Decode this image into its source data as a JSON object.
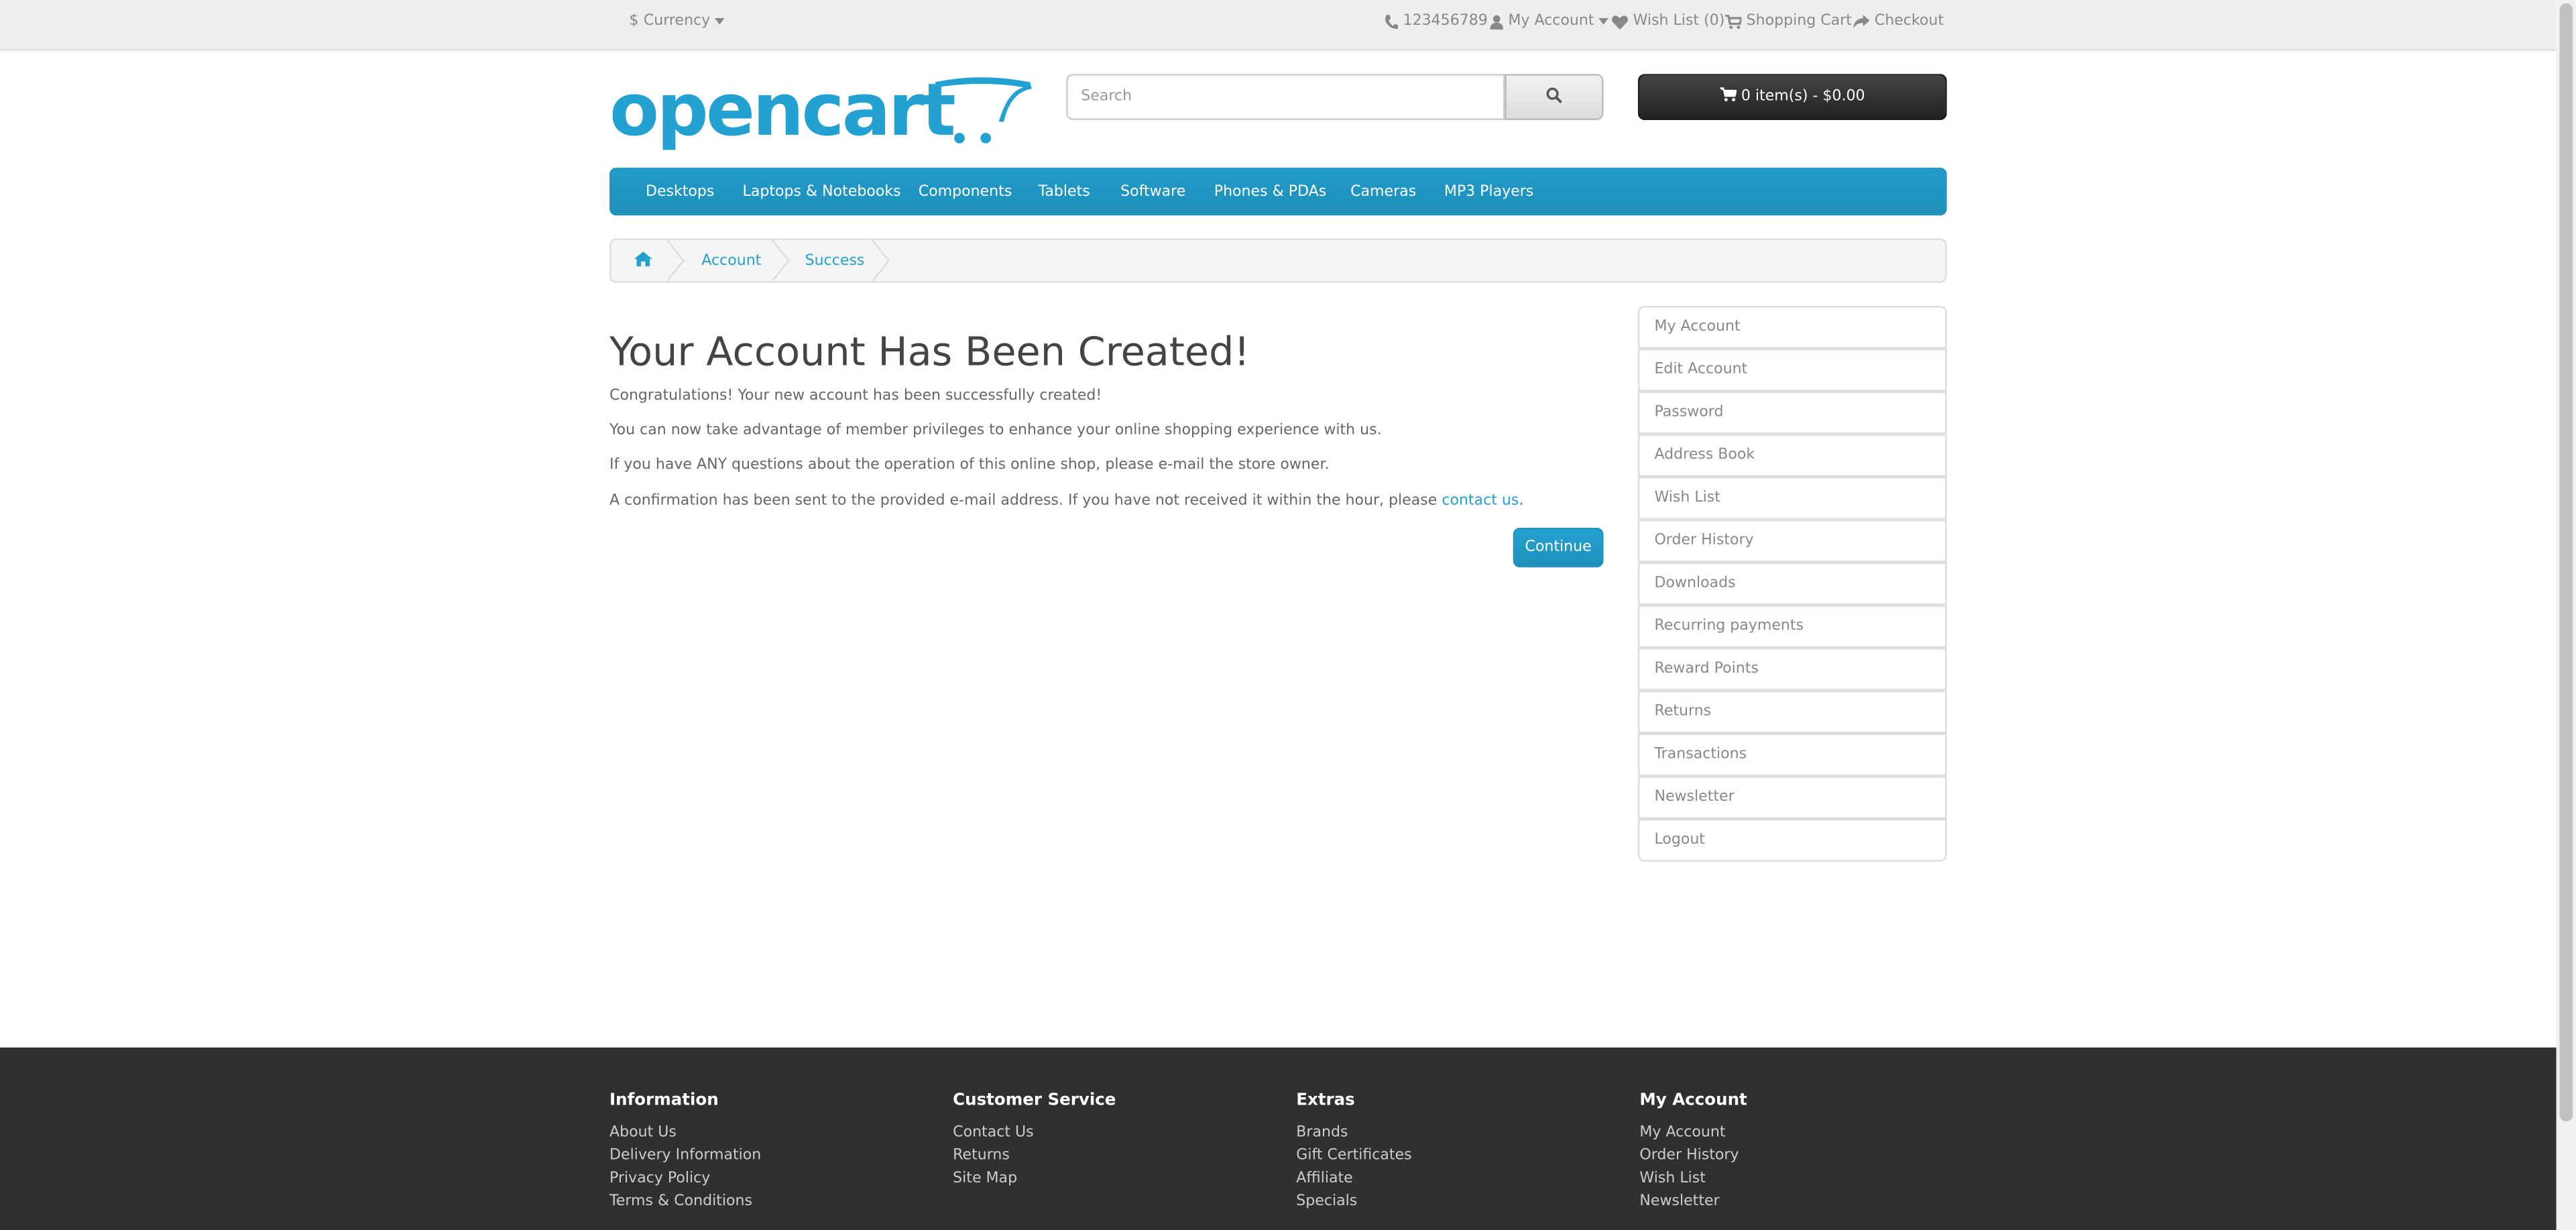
{
  "top_bar": {
    "currency_label": "Currency",
    "currency_symbol": "$",
    "phone": "123456789",
    "my_account": "My Account",
    "wish_list": "Wish List (0)",
    "shopping_cart": "Shopping Cart",
    "checkout": "Checkout"
  },
  "logo": {
    "text": "opencart"
  },
  "search": {
    "placeholder": "Search",
    "value": ""
  },
  "cart": {
    "label": "0 item(s) - $0.00"
  },
  "menu": {
    "items": [
      "Desktops",
      "Laptops & Notebooks",
      "Components",
      "Tablets",
      "Software",
      "Phones & PDAs",
      "Cameras",
      "MP3 Players"
    ]
  },
  "breadcrumb": {
    "items": [
      "Account",
      "Success"
    ]
  },
  "main": {
    "title": "Your Account Has Been Created!",
    "paragraphs": [
      "Congratulations! Your new account has been successfully created!",
      "You can now take advantage of member privileges to enhance your online shopping experience with us.",
      "If you have ANY questions about the operation of this online shop, please e-mail the store owner."
    ],
    "confirmation_text": "A confirmation has been sent to the provided e-mail address. If you have not received it within the hour, please",
    "contact_link": "contact us",
    "confirmation_end": ".",
    "continue_button": "Continue"
  },
  "sidebar": {
    "items": [
      "My Account",
      "Edit Account",
      "Password",
      "Address Book",
      "Wish List",
      "Order History",
      "Downloads",
      "Recurring payments",
      "Reward Points",
      "Returns",
      "Transactions",
      "Newsletter",
      "Logout"
    ]
  },
  "footer": {
    "columns": [
      {
        "heading": "Information",
        "links": [
          "About Us",
          "Delivery Information",
          "Privacy Policy",
          "Terms & Conditions"
        ]
      },
      {
        "heading": "Customer Service",
        "links": [
          "Contact Us",
          "Returns",
          "Site Map"
        ]
      },
      {
        "heading": "Extras",
        "links": [
          "Brands",
          "Gift Certificates",
          "Affiliate",
          "Specials"
        ]
      },
      {
        "heading": "My Account",
        "links": [
          "My Account",
          "Order History",
          "Wish List",
          "Newsletter"
        ]
      }
    ]
  },
  "colors": {
    "accent": "#23a1d1",
    "menu_bg": "#229ac8",
    "footer_bg": "#303030",
    "top_bar_bg": "#eeeeee"
  }
}
